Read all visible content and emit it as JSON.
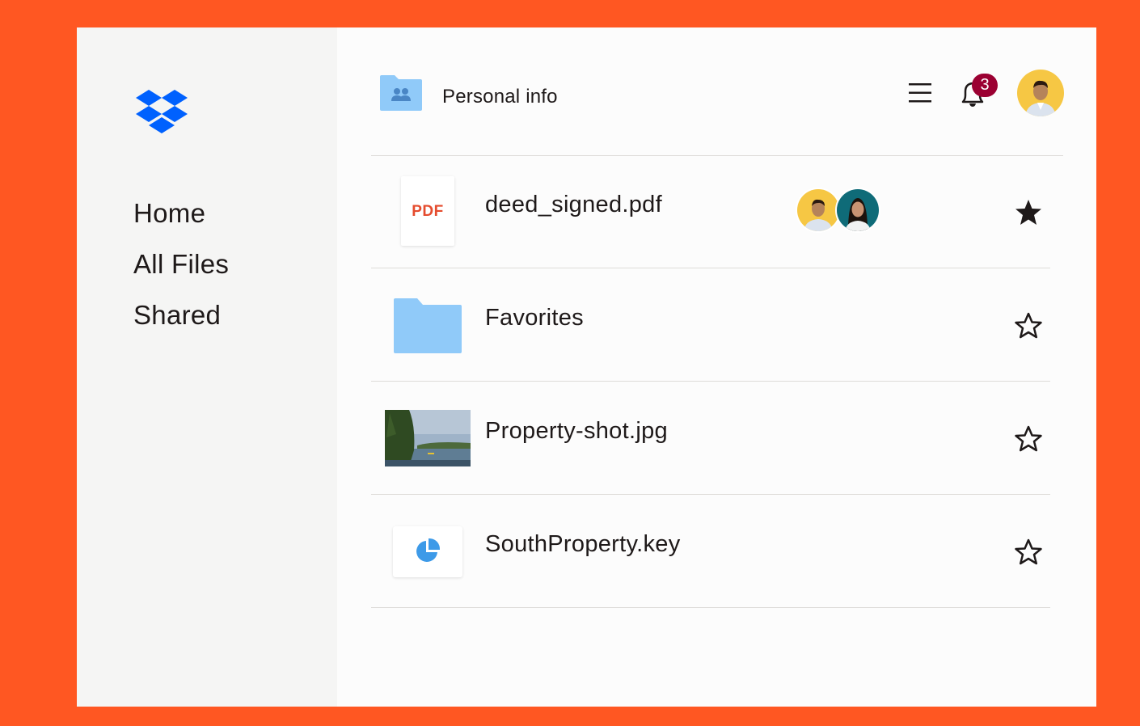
{
  "sidebar": {
    "nav": [
      {
        "label": "Home"
      },
      {
        "label": "All Files"
      },
      {
        "label": "Shared"
      }
    ]
  },
  "header": {
    "title": "Personal info",
    "folder_icon": "shared-folder-icon",
    "menu_icon": "hamburger-menu-icon",
    "bell_icon": "bell-icon",
    "notification_count": "3"
  },
  "files": [
    {
      "name": "deed_signed.pdf",
      "type_label": "PDF",
      "icon": "pdf-file-icon",
      "starred": true
    },
    {
      "name": "Favorites",
      "icon": "folder-icon",
      "starred": false
    },
    {
      "name": "Property-shot.jpg",
      "icon": "image-thumbnail",
      "starred": false
    },
    {
      "name": "SouthProperty.key",
      "icon": "keynote-pie-icon",
      "starred": false
    }
  ],
  "colors": {
    "background": "#FF5722",
    "sidebar": "#f5f5f4",
    "brand_blue": "#0061FE",
    "folder_blue": "#90CAF9",
    "badge": "#9b0032",
    "pdf_red": "#e54c2e"
  }
}
